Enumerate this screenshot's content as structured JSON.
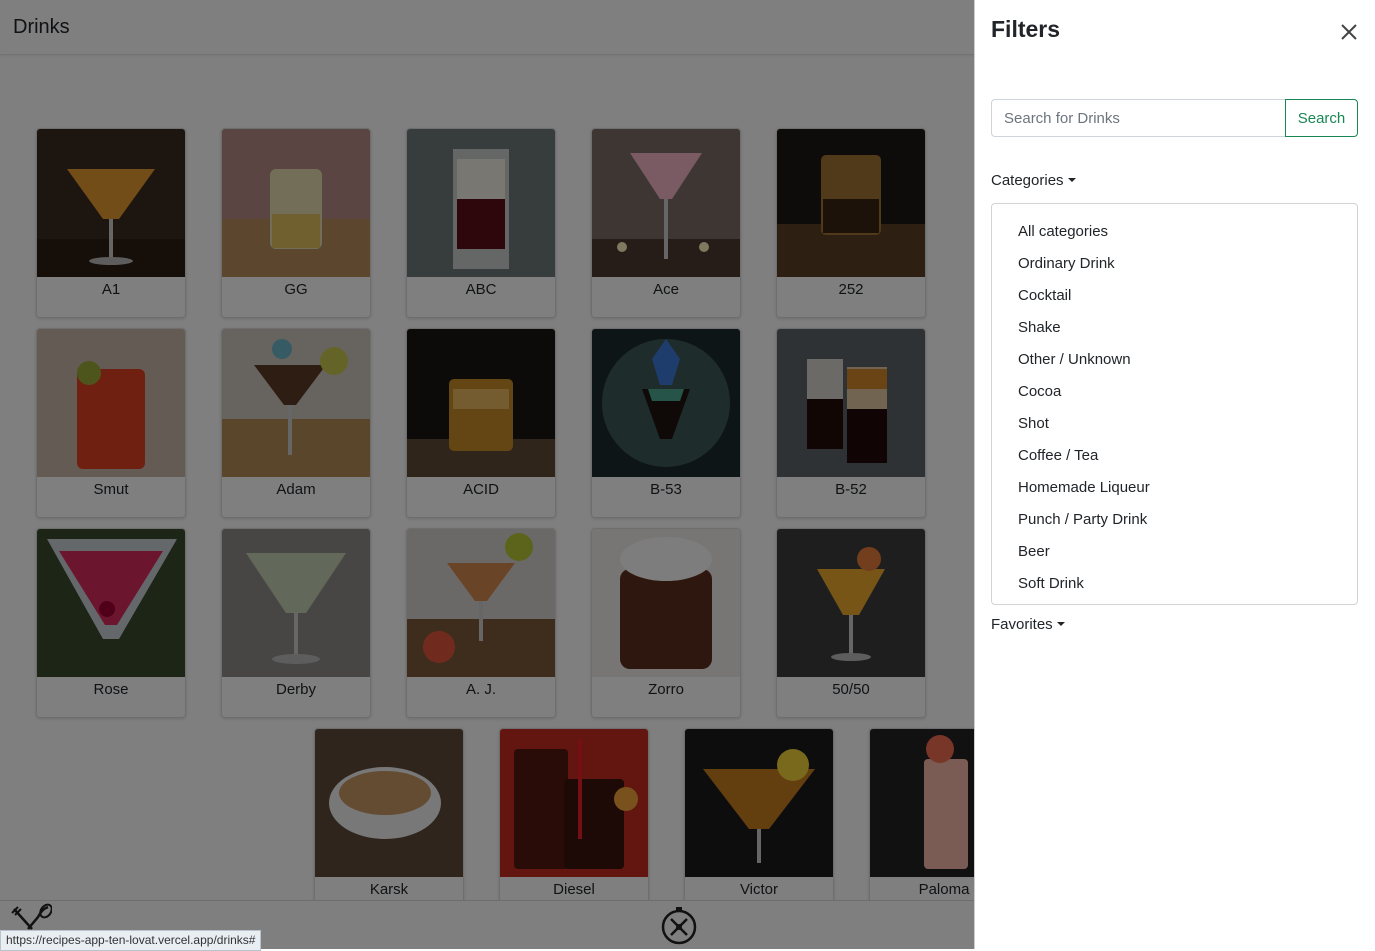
{
  "header": {
    "title": "Drinks"
  },
  "drinks": [
    {
      "name": "A1"
    },
    {
      "name": "GG"
    },
    {
      "name": "ABC"
    },
    {
      "name": "Ace"
    },
    {
      "name": "252"
    },
    {
      "name": "Smut"
    },
    {
      "name": "Adam"
    },
    {
      "name": "ACID"
    },
    {
      "name": "B-53"
    },
    {
      "name": "B-52"
    },
    {
      "name": "Rose"
    },
    {
      "name": "Derby"
    },
    {
      "name": "A. J."
    },
    {
      "name": "Zorro"
    },
    {
      "name": "50/50"
    },
    {
      "name": "Karsk"
    },
    {
      "name": "Diesel"
    },
    {
      "name": "Victor"
    },
    {
      "name": "Paloma"
    }
  ],
  "footer": {
    "meal_icon": "fork-spoon-icon",
    "drink_icon": "compass-drink-icon"
  },
  "status_url": "https://recipes-app-ten-lovat.vercel.app/drinks#",
  "filters": {
    "title": "Filters",
    "search": {
      "placeholder": "Search for Drinks",
      "value": "",
      "button_label": "Search"
    },
    "categories_label": "Categories",
    "categories": [
      "All categories",
      "Ordinary Drink",
      "Cocktail",
      "Shake",
      "Other / Unknown",
      "Cocoa",
      "Shot",
      "Coffee / Tea",
      "Homemade Liqueur",
      "Punch / Party Drink",
      "Beer",
      "Soft Drink"
    ],
    "favorites_label": "Favorites"
  },
  "colors": {
    "accent": "#198754",
    "overlay": "rgba(0,0,0,0.5)"
  }
}
